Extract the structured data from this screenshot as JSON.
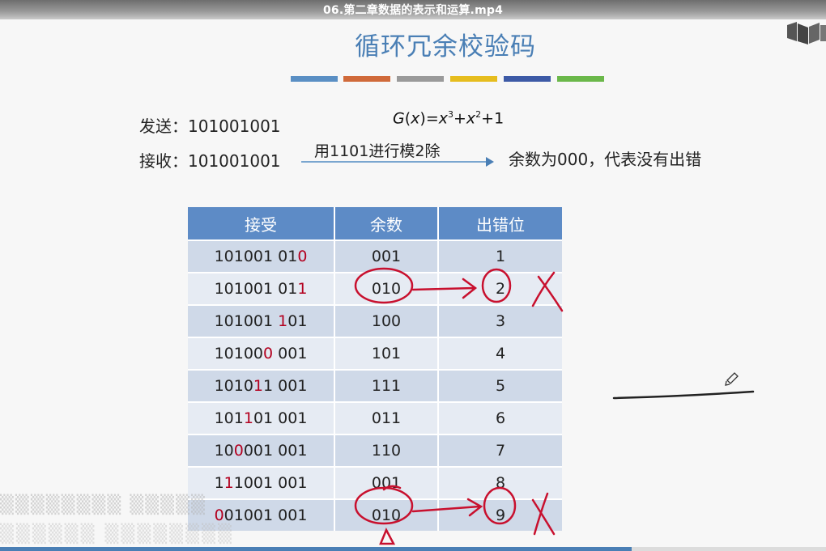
{
  "video": {
    "filename": "06.第二章数据的表示和运算.mp4",
    "progress_fraction": 0.765
  },
  "slide": {
    "title": "循环冗余校验码",
    "send_label": "发送：",
    "send_value": "101001001",
    "recv_label": "接收：",
    "recv_value": "101001001",
    "poly": {
      "G": "G",
      "x": "x",
      "eq": ")=",
      "open": "(",
      "x3": "x",
      "e3": "3",
      "plus1": "+",
      "x2": "x",
      "e2": "2",
      "plus2": "+1"
    },
    "arrow_text": "用1101进行模2除",
    "result_text": "余数为000，代表没有出错",
    "accent_bars": [
      "#5a8fc4",
      "#d06a3a",
      "#9a9a9a",
      "#e6bd1e",
      "#3d5aa6",
      "#6bb84a"
    ],
    "table": {
      "headers": [
        "接受",
        "余数",
        "出错位"
      ],
      "rows": [
        {
          "pre": "101001 01",
          "err": "0",
          "post": "",
          "rem": "001",
          "pos": "1"
        },
        {
          "pre": "101001 01",
          "err": "1",
          "post": "",
          "rem": "010",
          "pos": "2"
        },
        {
          "pre": "101001 ",
          "err": "1",
          "post": "01",
          "rem": "100",
          "pos": "3"
        },
        {
          "pre": "10100",
          "err": "0",
          "post": " 001",
          "rem": "101",
          "pos": "4"
        },
        {
          "pre": "1010",
          "err": "1",
          "post": "1 001",
          "rem": "111",
          "pos": "5"
        },
        {
          "pre": "101",
          "err": "1",
          "post": "01 001",
          "rem": "011",
          "pos": "6"
        },
        {
          "pre": "10",
          "err": "0",
          "post": "001 001",
          "rem": "110",
          "pos": "7"
        },
        {
          "pre": "1",
          "err": "1",
          "post": "1001 001",
          "rem": "001",
          "pos": "8"
        },
        {
          "pre": "",
          "err": "0",
          "post": "01001 001",
          "rem": "010",
          "pos": "9"
        }
      ]
    }
  }
}
